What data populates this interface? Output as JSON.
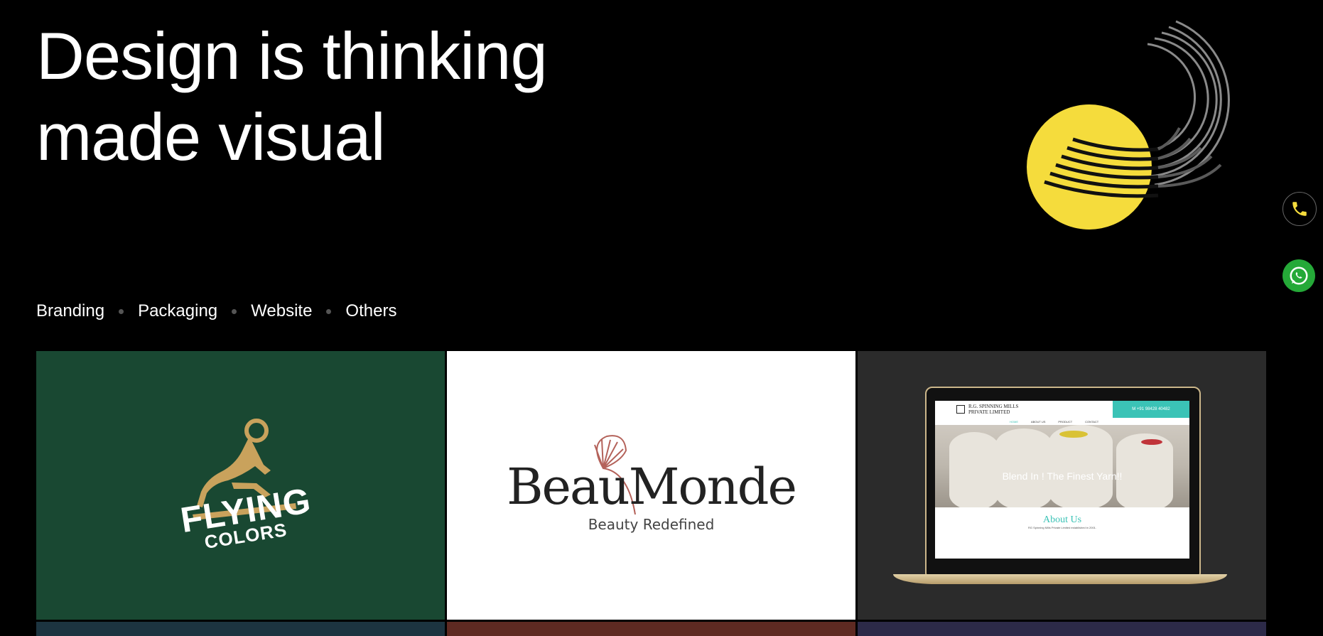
{
  "hero": {
    "title_line1": "Design is thinking",
    "title_line2": "made visual"
  },
  "filters": [
    {
      "label": "Branding"
    },
    {
      "label": "Packaging"
    },
    {
      "label": "Website"
    },
    {
      "label": "Others"
    }
  ],
  "portfolio": {
    "flying_colors": {
      "line1": "FLYING",
      "line2": "COLORS"
    },
    "beau_monde": {
      "name": "BeauMonde",
      "tagline": "Beauty Redefined"
    },
    "website": {
      "company": "R.G. SPINNING MILLS",
      "company_sub": "PRIVATE LIMITED",
      "phone": "M +91 98428 40482",
      "nav": [
        "HOME",
        "ABOUT US",
        "PRODUCT",
        "CONTACT"
      ],
      "hero_text": "Blend In ! The Finest Yarn!!",
      "about_title": "About Us",
      "about_text": "RG Spinning Mills Private Limited established in 2001."
    }
  },
  "colors": {
    "accent_yellow": "#f5dc3c",
    "flying_colors_bg": "#194832",
    "website_card_bg": "#2b2b2b",
    "teal": "#3bc3b6",
    "whatsapp_green": "#25a938"
  },
  "icons": {
    "phone": "phone-icon",
    "whatsapp": "whatsapp-icon"
  }
}
